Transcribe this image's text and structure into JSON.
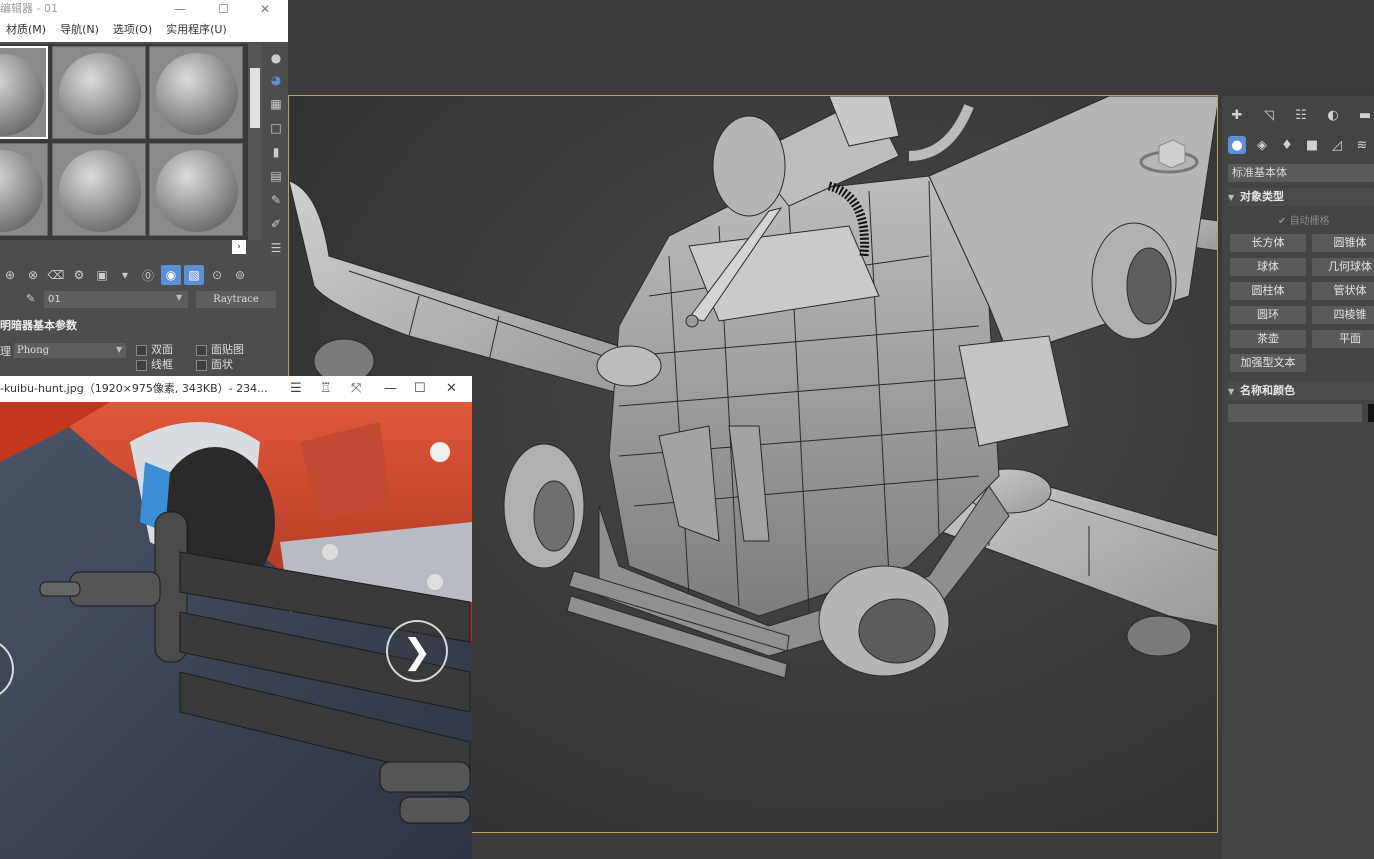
{
  "material_editor": {
    "title": "编辑器 - 01",
    "menu": [
      "材质(M)",
      "导航(N)",
      "选项(O)",
      "实用程序(U)"
    ],
    "material_name": "01",
    "material_type": "Raytrace",
    "rollout_title": "明暗器基本参数",
    "shader_label": "理",
    "shader_value": "Phong",
    "checkboxes": [
      "双面",
      "面贴图",
      "线框",
      "面状"
    ]
  },
  "image_viewer": {
    "title": "-kuibu-hunt.jpg（1920×975像素, 343KB）- 234...",
    "next_glyph": "❯",
    "prev_glyph": "❮"
  },
  "command_panel": {
    "category_dropdown": "标准基本体",
    "object_type_header": "对象类型",
    "autogrid_label": "自动栅格",
    "buttons": [
      "长方体",
      "圆锥体",
      "球体",
      "几何球体",
      "圆柱体",
      "管状体",
      "圆环",
      "四棱锥",
      "茶壶",
      "平面",
      "加强型文本"
    ],
    "name_color_header": "名称和颜色"
  },
  "colors": {
    "viewport_border": "#b8a35a",
    "active_blue": "#5c8fd6",
    "panel_bg": "#444444"
  }
}
